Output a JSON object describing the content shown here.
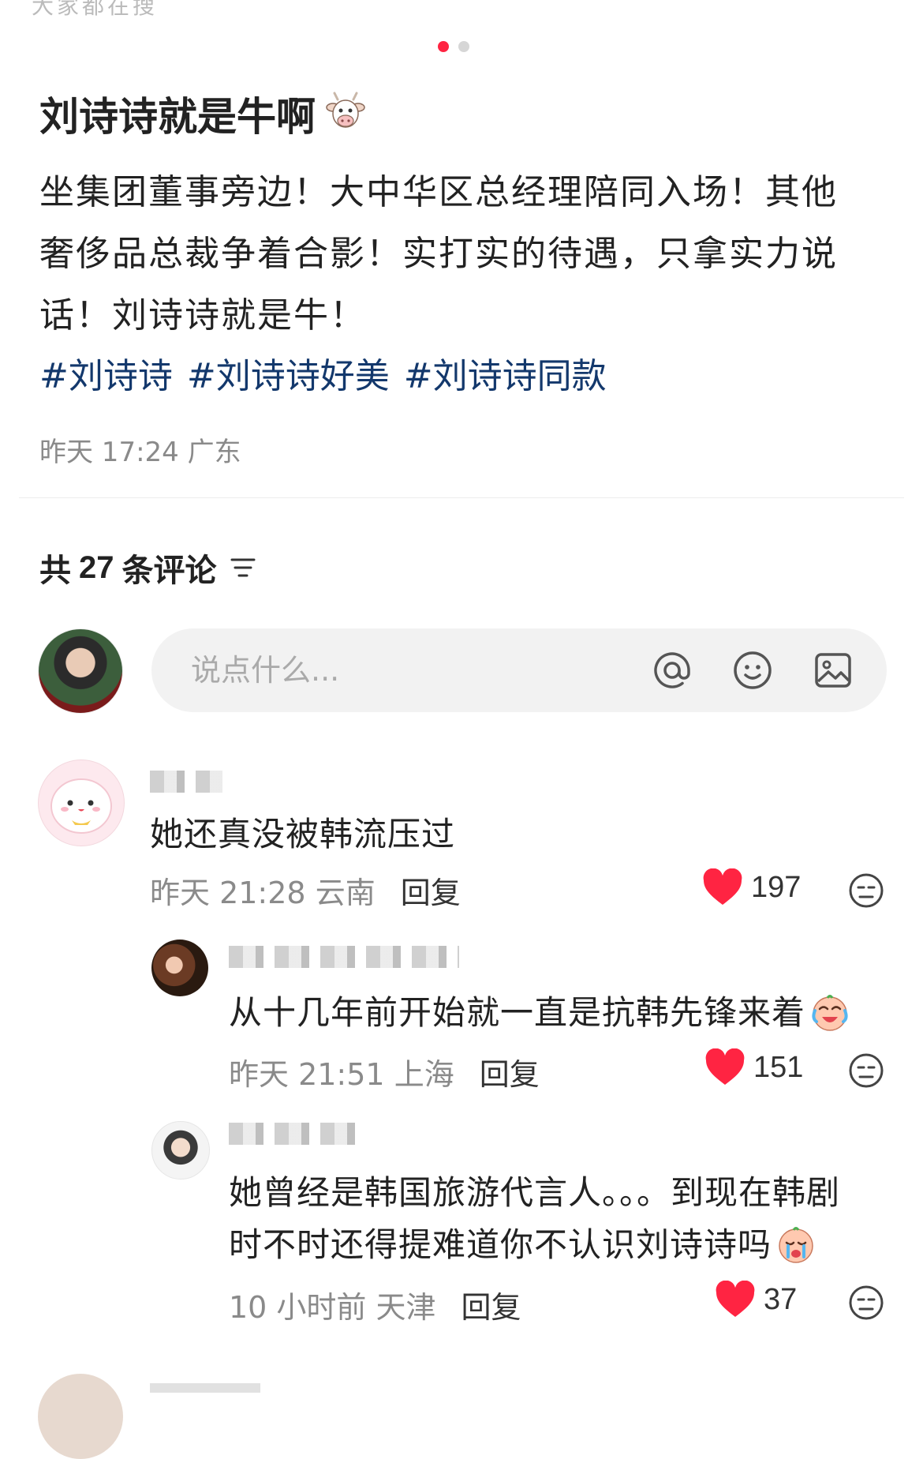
{
  "top_cutoff_text": "大家都在搜",
  "carousel": {
    "total": 2,
    "active": 1
  },
  "post": {
    "title": "刘诗诗就是牛啊",
    "title_emoji": "cow-face",
    "body": "坐集团董事旁边！大中华区总经理陪同入场！其他奢侈品总裁争着合影！实打实的待遇，只拿实力说话！刘诗诗就是牛！",
    "tags": [
      "#刘诗诗",
      "#刘诗诗好美",
      "#刘诗诗同款"
    ],
    "time": "昨天 17:24",
    "location": "广东",
    "tag_color": "#13386c"
  },
  "comments_header": {
    "prefix": "共",
    "count": "27",
    "suffix": "条评论"
  },
  "comment_input": {
    "placeholder": "说点什么..."
  },
  "accent_color": "#ff2442",
  "comments": [
    {
      "text": "她还真没被韩流压过",
      "time": "昨天 21:28",
      "location": "云南",
      "reply_label": "回复",
      "likes": "197"
    },
    {
      "text": "从十几年前开始就一直是抗韩先锋来着",
      "emoji": "laughing-crying-face",
      "time": "昨天 21:51",
      "location": "上海",
      "reply_label": "回复",
      "likes": "151"
    },
    {
      "text_line1": "她曾经是韩国旅游代言人。。。到现在韩剧",
      "text_line2": "时不时还得提难道你不认识刘诗诗吗",
      "emoji": "crying-face",
      "time": "10 小时前",
      "location": "天津",
      "reply_label": "回复",
      "likes": "37"
    }
  ]
}
